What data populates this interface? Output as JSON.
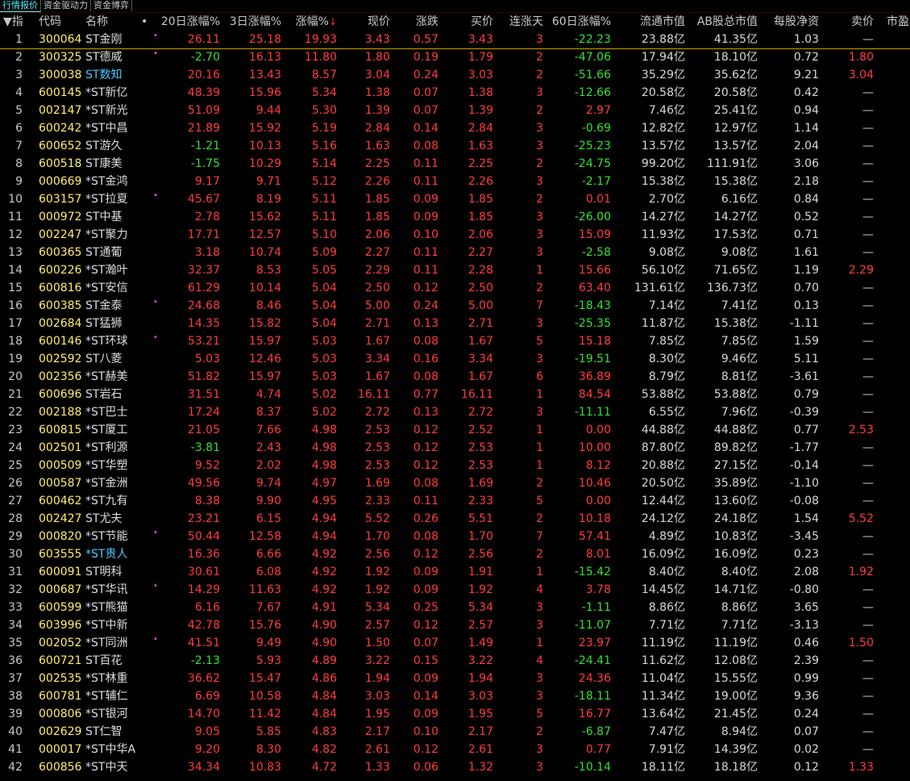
{
  "tabs": [
    "行情报价",
    "资金驱动力",
    "资金博弈"
  ],
  "headers": {
    "idx": "指",
    "code": "代码",
    "name": "名称",
    "dot": "•",
    "chg20": "20日涨幅%",
    "chg3": "3日涨幅%",
    "chg": "涨幅%",
    "price": "现价",
    "diff": "涨跌",
    "bid": "买价",
    "streak": "连涨天",
    "chg60": "60日涨幅%",
    "float_cap": "流通市值",
    "ab_cap": "AB股总市值",
    "nav": "每股净资",
    "ask": "卖价",
    "pe": "市盈"
  },
  "rows": [
    {
      "n": "1",
      "code": "300064",
      "name": "ST金刚",
      "m": true,
      "c20": "26.11",
      "c3": "25.18",
      "c": "19.93",
      "p": "3.43",
      "d": "0.57",
      "b": "3.43",
      "s": "3",
      "c60": "-22.23",
      "fc": "23.88亿",
      "ab": "41.35亿",
      "nav": "1.03",
      "ask": "—"
    },
    {
      "n": "2",
      "code": "300325",
      "name": "ST德威",
      "m": true,
      "c20": "-2.70",
      "c3": "16.13",
      "c": "11.80",
      "p": "1.80",
      "d": "0.19",
      "b": "1.79",
      "s": "2",
      "c60": "-47.06",
      "fc": "17.94亿",
      "ab": "18.10亿",
      "nav": "0.72",
      "ask": "1.80"
    },
    {
      "n": "3",
      "code": "300038",
      "name": "ST数知",
      "hl": true,
      "c20": "20.16",
      "c3": "13.43",
      "c": "8.57",
      "p": "3.04",
      "d": "0.24",
      "b": "3.03",
      "s": "2",
      "c60": "-51.66",
      "fc": "35.29亿",
      "ab": "35.62亿",
      "nav": "9.21",
      "ask": "3.04"
    },
    {
      "n": "4",
      "code": "600145",
      "name": "*ST新亿",
      "c20": "48.39",
      "c3": "15.96",
      "c": "5.34",
      "p": "1.38",
      "d": "0.07",
      "b": "1.38",
      "s": "3",
      "c60": "-12.66",
      "fc": "20.58亿",
      "ab": "20.58亿",
      "nav": "0.42",
      "ask": "—"
    },
    {
      "n": "5",
      "code": "002147",
      "name": "*ST新光",
      "c20": "51.09",
      "c3": "9.44",
      "c": "5.30",
      "p": "1.39",
      "d": "0.07",
      "b": "1.39",
      "s": "2",
      "c60": "2.97",
      "fc": "7.46亿",
      "ab": "25.41亿",
      "nav": "0.94",
      "ask": "—"
    },
    {
      "n": "6",
      "code": "600242",
      "name": "*ST中昌",
      "c20": "21.89",
      "c3": "15.92",
      "c": "5.19",
      "p": "2.84",
      "d": "0.14",
      "b": "2.84",
      "s": "3",
      "c60": "-0.69",
      "fc": "12.82亿",
      "ab": "12.97亿",
      "nav": "1.14",
      "ask": "—"
    },
    {
      "n": "7",
      "code": "600652",
      "name": "ST游久",
      "c20": "-1.21",
      "c3": "10.13",
      "c": "5.16",
      "p": "1.63",
      "d": "0.08",
      "b": "1.63",
      "s": "3",
      "c60": "-25.23",
      "fc": "13.57亿",
      "ab": "13.57亿",
      "nav": "2.04",
      "ask": "—"
    },
    {
      "n": "8",
      "code": "600518",
      "name": "ST康美",
      "c20": "-1.75",
      "c3": "10.29",
      "c": "5.14",
      "p": "2.25",
      "d": "0.11",
      "b": "2.25",
      "s": "2",
      "c60": "-24.75",
      "fc": "99.20亿",
      "ab": "111.91亿",
      "nav": "3.06",
      "ask": "—"
    },
    {
      "n": "9",
      "code": "000669",
      "name": "*ST金鸿",
      "c20": "9.17",
      "c3": "9.71",
      "c": "5.12",
      "p": "2.26",
      "d": "0.11",
      "b": "2.26",
      "s": "3",
      "c60": "-2.17",
      "fc": "15.38亿",
      "ab": "15.38亿",
      "nav": "2.18",
      "ask": "—"
    },
    {
      "n": "10",
      "code": "603157",
      "name": "*ST拉夏",
      "m": true,
      "c20": "45.67",
      "c3": "8.19",
      "c": "5.11",
      "p": "1.85",
      "d": "0.09",
      "b": "1.85",
      "s": "2",
      "c60": "0.01",
      "fc": "2.70亿",
      "ab": "6.16亿",
      "nav": "0.84",
      "ask": "—"
    },
    {
      "n": "11",
      "code": "000972",
      "name": "ST中基",
      "c20": "2.78",
      "c3": "15.62",
      "c": "5.11",
      "p": "1.85",
      "d": "0.09",
      "b": "1.85",
      "s": "3",
      "c60": "-26.00",
      "fc": "14.27亿",
      "ab": "14.27亿",
      "nav": "0.52",
      "ask": "—"
    },
    {
      "n": "12",
      "code": "002247",
      "name": "*ST聚力",
      "c20": "17.71",
      "c3": "12.57",
      "c": "5.10",
      "p": "2.06",
      "d": "0.10",
      "b": "2.06",
      "s": "3",
      "c60": "15.09",
      "fc": "11.93亿",
      "ab": "17.53亿",
      "nav": "0.71",
      "ask": "—"
    },
    {
      "n": "13",
      "code": "600365",
      "name": "ST通葡",
      "c20": "3.18",
      "c3": "10.74",
      "c": "5.09",
      "p": "2.27",
      "d": "0.11",
      "b": "2.27",
      "s": "3",
      "c60": "-2.58",
      "fc": "9.08亿",
      "ab": "9.08亿",
      "nav": "1.61",
      "ask": "—"
    },
    {
      "n": "14",
      "code": "600226",
      "name": "*ST瀚叶",
      "c20": "32.37",
      "c3": "8.53",
      "c": "5.05",
      "p": "2.29",
      "d": "0.11",
      "b": "2.28",
      "s": "1",
      "c60": "15.66",
      "fc": "56.10亿",
      "ab": "71.65亿",
      "nav": "1.19",
      "ask": "2.29"
    },
    {
      "n": "15",
      "code": "600816",
      "name": "*ST安信",
      "c20": "61.29",
      "c3": "10.14",
      "c": "5.04",
      "p": "2.50",
      "d": "0.12",
      "b": "2.50",
      "s": "2",
      "c60": "63.40",
      "fc": "131.61亿",
      "ab": "136.73亿",
      "nav": "0.70",
      "ask": "—"
    },
    {
      "n": "16",
      "code": "600385",
      "name": "ST金泰",
      "m": true,
      "c20": "24.68",
      "c3": "8.46",
      "c": "5.04",
      "p": "5.00",
      "d": "0.24",
      "b": "5.00",
      "s": "7",
      "c60": "-18.43",
      "fc": "7.14亿",
      "ab": "7.41亿",
      "nav": "0.13",
      "ask": "—"
    },
    {
      "n": "17",
      "code": "002684",
      "name": "ST猛狮",
      "c20": "14.35",
      "c3": "15.82",
      "c": "5.04",
      "p": "2.71",
      "d": "0.13",
      "b": "2.71",
      "s": "3",
      "c60": "-25.35",
      "fc": "11.87亿",
      "ab": "15.38亿",
      "nav": "-1.11",
      "ask": "—"
    },
    {
      "n": "18",
      "code": "600146",
      "name": "*ST环球",
      "m": true,
      "c20": "53.21",
      "c3": "15.97",
      "c": "5.03",
      "p": "1.67",
      "d": "0.08",
      "b": "1.67",
      "s": "5",
      "c60": "15.18",
      "fc": "7.85亿",
      "ab": "7.85亿",
      "nav": "1.59",
      "ask": "—"
    },
    {
      "n": "19",
      "code": "002592",
      "name": "ST八菱",
      "c20": "5.03",
      "c3": "12.46",
      "c": "5.03",
      "p": "3.34",
      "d": "0.16",
      "b": "3.34",
      "s": "3",
      "c60": "-19.51",
      "fc": "8.30亿",
      "ab": "9.46亿",
      "nav": "5.11",
      "ask": "—"
    },
    {
      "n": "20",
      "code": "002356",
      "name": "*ST赫美",
      "c20": "51.82",
      "c3": "15.97",
      "c": "5.03",
      "p": "1.67",
      "d": "0.08",
      "b": "1.67",
      "s": "6",
      "c60": "36.89",
      "fc": "8.79亿",
      "ab": "8.81亿",
      "nav": "-3.61",
      "ask": "—"
    },
    {
      "n": "21",
      "code": "600696",
      "name": "ST岩石",
      "c20": "31.51",
      "c3": "4.74",
      "c": "5.02",
      "p": "16.11",
      "d": "0.77",
      "b": "16.11",
      "s": "1",
      "c60": "84.54",
      "fc": "53.88亿",
      "ab": "53.88亿",
      "nav": "0.79",
      "ask": "—"
    },
    {
      "n": "22",
      "code": "002188",
      "name": "*ST巴士",
      "c20": "17.24",
      "c3": "8.37",
      "c": "5.02",
      "p": "2.72",
      "d": "0.13",
      "b": "2.72",
      "s": "3",
      "c60": "-11.11",
      "fc": "6.55亿",
      "ab": "7.96亿",
      "nav": "-0.39",
      "ask": "—"
    },
    {
      "n": "23",
      "code": "600815",
      "name": "*ST厦工",
      "c20": "21.05",
      "c3": "7.66",
      "c": "4.98",
      "p": "2.53",
      "d": "0.12",
      "b": "2.52",
      "s": "1",
      "c60": "0.00",
      "fc": "44.88亿",
      "ab": "44.88亿",
      "nav": "0.77",
      "ask": "2.53"
    },
    {
      "n": "24",
      "code": "002501",
      "name": "*ST利源",
      "c20": "-3.81",
      "c3": "2.43",
      "c": "4.98",
      "p": "2.53",
      "d": "0.12",
      "b": "2.53",
      "s": "1",
      "c60": "10.00",
      "fc": "87.80亿",
      "ab": "89.82亿",
      "nav": "-1.77",
      "ask": "—"
    },
    {
      "n": "25",
      "code": "000509",
      "name": "*ST华塑",
      "c20": "9.52",
      "c3": "2.02",
      "c": "4.98",
      "p": "2.53",
      "d": "0.12",
      "b": "2.53",
      "s": "1",
      "c60": "8.12",
      "fc": "20.88亿",
      "ab": "27.15亿",
      "nav": "-0.14",
      "ask": "—"
    },
    {
      "n": "26",
      "code": "000587",
      "name": "*ST金洲",
      "c20": "49.56",
      "c3": "9.74",
      "c": "4.97",
      "p": "1.69",
      "d": "0.08",
      "b": "1.69",
      "s": "2",
      "c60": "10.46",
      "fc": "20.50亿",
      "ab": "35.89亿",
      "nav": "-1.10",
      "ask": "—"
    },
    {
      "n": "27",
      "code": "600462",
      "name": "*ST九有",
      "c20": "8.38",
      "c3": "9.90",
      "c": "4.95",
      "p": "2.33",
      "d": "0.11",
      "b": "2.33",
      "s": "5",
      "c60": "0.00",
      "fc": "12.44亿",
      "ab": "13.60亿",
      "nav": "-0.08",
      "ask": "—"
    },
    {
      "n": "28",
      "code": "002427",
      "name": "ST尤夫",
      "c20": "23.21",
      "c3": "6.15",
      "c": "4.94",
      "p": "5.52",
      "d": "0.26",
      "b": "5.51",
      "s": "2",
      "c60": "10.18",
      "fc": "24.12亿",
      "ab": "24.18亿",
      "nav": "1.54",
      "ask": "5.52"
    },
    {
      "n": "29",
      "code": "000820",
      "name": "*ST节能",
      "m": true,
      "c20": "50.44",
      "c3": "12.58",
      "c": "4.94",
      "p": "1.70",
      "d": "0.08",
      "b": "1.70",
      "s": "7",
      "c60": "57.41",
      "fc": "4.89亿",
      "ab": "10.83亿",
      "nav": "-3.45",
      "ask": "—"
    },
    {
      "n": "30",
      "code": "603555",
      "name": "*ST贵人",
      "hl": true,
      "c20": "16.36",
      "c3": "6.66",
      "c": "4.92",
      "p": "2.56",
      "d": "0.12",
      "b": "2.56",
      "s": "2",
      "c60": "8.01",
      "fc": "16.09亿",
      "ab": "16.09亿",
      "nav": "0.23",
      "ask": "—"
    },
    {
      "n": "31",
      "code": "600091",
      "name": "ST明科",
      "c20": "30.61",
      "c3": "6.08",
      "c": "4.92",
      "p": "1.92",
      "d": "0.09",
      "b": "1.91",
      "s": "1",
      "c60": "-15.42",
      "fc": "8.40亿",
      "ab": "8.40亿",
      "nav": "2.08",
      "ask": "1.92"
    },
    {
      "n": "32",
      "code": "000687",
      "name": "*ST华讯",
      "m": true,
      "c20": "14.29",
      "c3": "11.63",
      "c": "4.92",
      "p": "1.92",
      "d": "0.09",
      "b": "1.92",
      "s": "4",
      "c60": "3.78",
      "fc": "14.45亿",
      "ab": "14.71亿",
      "nav": "-0.80",
      "ask": "—"
    },
    {
      "n": "33",
      "code": "600599",
      "name": "*ST熊猫",
      "c20": "6.16",
      "c3": "7.67",
      "c": "4.91",
      "p": "5.34",
      "d": "0.25",
      "b": "5.34",
      "s": "3",
      "c60": "-1.11",
      "fc": "8.86亿",
      "ab": "8.86亿",
      "nav": "3.65",
      "ask": "—"
    },
    {
      "n": "34",
      "code": "603996",
      "name": "*ST中新",
      "c20": "42.78",
      "c3": "15.76",
      "c": "4.90",
      "p": "2.57",
      "d": "0.12",
      "b": "2.57",
      "s": "3",
      "c60": "-11.07",
      "fc": "7.71亿",
      "ab": "7.71亿",
      "nav": "-3.13",
      "ask": "—"
    },
    {
      "n": "35",
      "code": "002052",
      "name": "*ST同洲",
      "m": true,
      "c20": "41.51",
      "c3": "9.49",
      "c": "4.90",
      "p": "1.50",
      "d": "0.07",
      "b": "1.49",
      "s": "1",
      "c60": "23.97",
      "fc": "11.19亿",
      "ab": "11.19亿",
      "nav": "0.46",
      "ask": "1.50"
    },
    {
      "n": "36",
      "code": "600721",
      "name": "ST百花",
      "c20": "-2.13",
      "c3": "5.93",
      "c": "4.89",
      "p": "3.22",
      "d": "0.15",
      "b": "3.22",
      "s": "4",
      "c60": "-24.41",
      "fc": "11.62亿",
      "ab": "12.08亿",
      "nav": "2.39",
      "ask": "—"
    },
    {
      "n": "37",
      "code": "002535",
      "name": "*ST林重",
      "c20": "36.62",
      "c3": "15.47",
      "c": "4.86",
      "p": "1.94",
      "d": "0.09",
      "b": "1.94",
      "s": "3",
      "c60": "24.36",
      "fc": "11.04亿",
      "ab": "15.55亿",
      "nav": "0.99",
      "ask": "—"
    },
    {
      "n": "38",
      "code": "600781",
      "name": "*ST辅仁",
      "c20": "6.69",
      "c3": "10.58",
      "c": "4.84",
      "p": "3.03",
      "d": "0.14",
      "b": "3.03",
      "s": "3",
      "c60": "-18.11",
      "fc": "11.34亿",
      "ab": "19.00亿",
      "nav": "9.36",
      "ask": "—"
    },
    {
      "n": "39",
      "code": "000806",
      "name": "*ST银河",
      "c20": "14.70",
      "c3": "11.42",
      "c": "4.84",
      "p": "1.95",
      "d": "0.09",
      "b": "1.95",
      "s": "5",
      "c60": "16.77",
      "fc": "13.64亿",
      "ab": "21.45亿",
      "nav": "0.24",
      "ask": "—"
    },
    {
      "n": "40",
      "code": "002629",
      "name": "ST仁智",
      "c20": "9.05",
      "c3": "5.85",
      "c": "4.83",
      "p": "2.17",
      "d": "0.10",
      "b": "2.17",
      "s": "2",
      "c60": "-6.87",
      "fc": "7.47亿",
      "ab": "8.94亿",
      "nav": "0.07",
      "ask": "—"
    },
    {
      "n": "41",
      "code": "000017",
      "name": "*ST中华A",
      "c20": "9.20",
      "c3": "8.30",
      "c": "4.82",
      "p": "2.61",
      "d": "0.12",
      "b": "2.61",
      "s": "3",
      "c60": "0.77",
      "fc": "7.91亿",
      "ab": "14.39亿",
      "nav": "0.02",
      "ask": "—"
    },
    {
      "n": "42",
      "code": "600856",
      "name": "*ST中天",
      "c20": "34.34",
      "c3": "10.83",
      "c": "4.72",
      "p": "1.33",
      "d": "0.06",
      "b": "1.32",
      "s": "3",
      "c60": "-10.14",
      "fc": "18.11亿",
      "ab": "18.18亿",
      "nav": "0.12",
      "ask": "1.33"
    }
  ]
}
